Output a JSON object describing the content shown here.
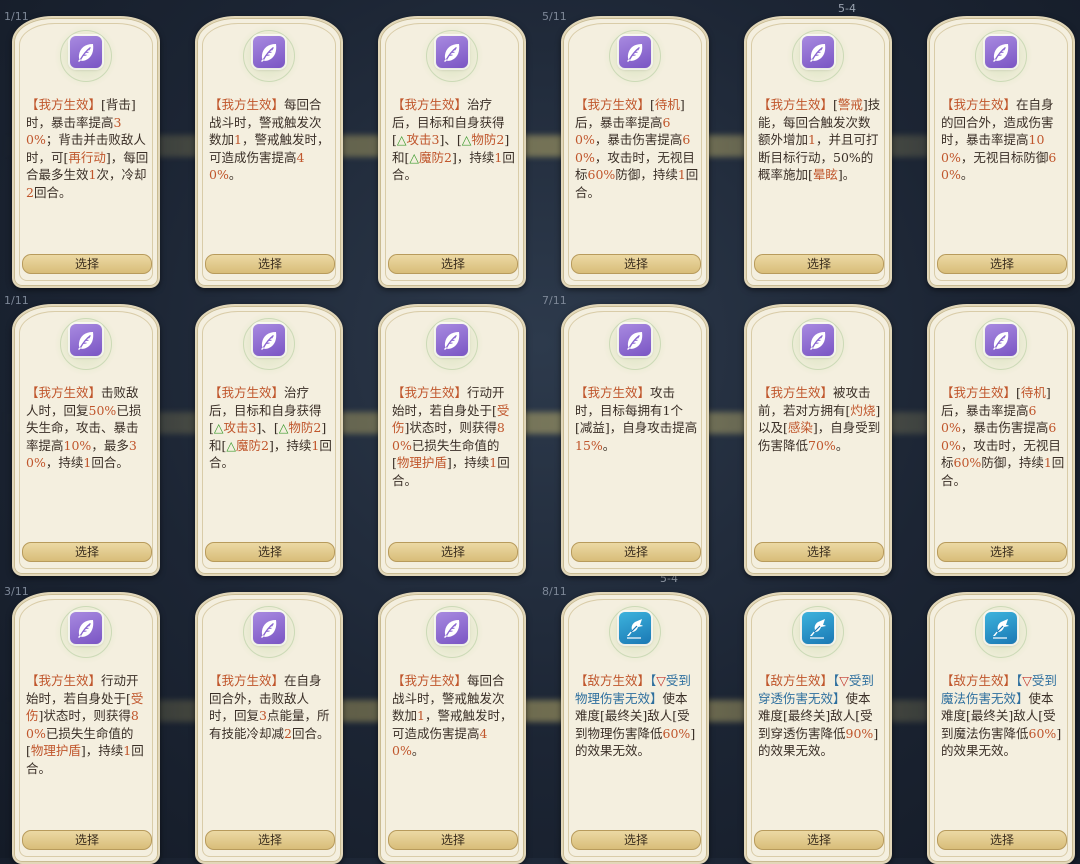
{
  "pagers": [
    "1/11",
    "5/11",
    "1/11",
    "7/11",
    "3/11",
    "8/11"
  ],
  "stage_labels": [
    "5-4",
    "5-4"
  ],
  "select_label": "选择",
  "colors": {
    "card_bg": "#f4efdf",
    "ally_icon": "#8a66d0",
    "enemy_icon": "#2a94c8",
    "highlight": "#c0562c",
    "buff_green": "#3b9a2c",
    "debuff_red": "#c0352c"
  },
  "cards": [
    {
      "icon": "leaf-icon",
      "side": "ally",
      "parts": [
        [
          "tag",
          "【我方生效】"
        ],
        [
          "t",
          "[背击]时，暴击率提高"
        ],
        [
          "num",
          "30%"
        ],
        [
          "t",
          "；背击并击败敌人时，可["
        ],
        [
          "kw",
          "再行动"
        ],
        [
          "t",
          "]，每回合最多生效"
        ],
        [
          "num",
          "1"
        ],
        [
          "t",
          "次，冷却"
        ],
        [
          "num",
          "2"
        ],
        [
          "t",
          "回合。"
        ]
      ]
    },
    {
      "icon": "leaf-icon",
      "side": "ally",
      "parts": [
        [
          "tag",
          "【我方生效】"
        ],
        [
          "t",
          "每回合战斗时，警戒触发次数加"
        ],
        [
          "num",
          "1"
        ],
        [
          "t",
          "，警戒触发时，可造成伤害提高"
        ],
        [
          "num",
          "40%"
        ],
        [
          "t",
          "。"
        ]
      ]
    },
    {
      "icon": "leaf-icon",
      "side": "ally",
      "parts": [
        [
          "tag",
          "【我方生效】"
        ],
        [
          "t",
          "治疗后，目标和自身获得["
        ],
        [
          "up",
          "△"
        ],
        [
          "kw",
          "攻击3"
        ],
        [
          "t",
          "]、["
        ],
        [
          "up",
          "△"
        ],
        [
          "kw",
          "物防2"
        ],
        [
          "t",
          "]和["
        ],
        [
          "up",
          "△"
        ],
        [
          "kw",
          "魔防2"
        ],
        [
          "t",
          "]，持续"
        ],
        [
          "num",
          "1"
        ],
        [
          "t",
          "回合。"
        ]
      ]
    },
    {
      "icon": "leaf-icon",
      "side": "ally",
      "parts": [
        [
          "tag",
          "【我方生效】"
        ],
        [
          "t",
          "["
        ],
        [
          "kw",
          "待机"
        ],
        [
          "t",
          "]后，暴击率提高"
        ],
        [
          "num",
          "60%"
        ],
        [
          "t",
          "，暴击伤害提高"
        ],
        [
          "num",
          "60%"
        ],
        [
          "t",
          "，攻击时，无视目标"
        ],
        [
          "num",
          "60%"
        ],
        [
          "t",
          "防御，持续"
        ],
        [
          "num",
          "1"
        ],
        [
          "t",
          "回合。"
        ]
      ]
    },
    {
      "icon": "leaf-icon",
      "side": "ally",
      "parts": [
        [
          "tag",
          "【我方生效】"
        ],
        [
          "t",
          "["
        ],
        [
          "kw",
          "警戒"
        ],
        [
          "t",
          "]技能，每回合触发次数额外增加"
        ],
        [
          "num",
          "1"
        ],
        [
          "t",
          "，并且可打断目标行动，50%的概率施加["
        ],
        [
          "kw",
          "晕眩"
        ],
        [
          "t",
          "]。"
        ]
      ]
    },
    {
      "icon": "leaf-icon",
      "side": "ally",
      "parts": [
        [
          "tag",
          "【我方生效】"
        ],
        [
          "t",
          "在自身的回合外，造成伤害时，暴击率提高"
        ],
        [
          "num",
          "100%"
        ],
        [
          "t",
          "，无视目标防御"
        ],
        [
          "num",
          "60%"
        ],
        [
          "t",
          "。"
        ]
      ]
    },
    {
      "icon": "leaf-icon",
      "side": "ally",
      "parts": [
        [
          "tag",
          "【我方生效】"
        ],
        [
          "t",
          "击败敌人时，回复"
        ],
        [
          "num",
          "50%"
        ],
        [
          "t",
          "已损失生命，攻击、暴击率提高"
        ],
        [
          "num",
          "10%"
        ],
        [
          "t",
          "，最多"
        ],
        [
          "num",
          "30%"
        ],
        [
          "t",
          "，持续"
        ],
        [
          "num",
          "1"
        ],
        [
          "t",
          "回合。"
        ]
      ]
    },
    {
      "icon": "leaf-icon",
      "side": "ally",
      "parts": [
        [
          "tag",
          "【我方生效】"
        ],
        [
          "t",
          "治疗后，目标和自身获得["
        ],
        [
          "up",
          "△"
        ],
        [
          "kw",
          "攻击3"
        ],
        [
          "t",
          "]、["
        ],
        [
          "up",
          "△"
        ],
        [
          "kw",
          "物防2"
        ],
        [
          "t",
          "]和["
        ],
        [
          "up",
          "△"
        ],
        [
          "kw",
          "魔防2"
        ],
        [
          "t",
          "]，持续"
        ],
        [
          "num",
          "1"
        ],
        [
          "t",
          "回合。"
        ]
      ]
    },
    {
      "icon": "leaf-icon",
      "side": "ally",
      "parts": [
        [
          "tag",
          "【我方生效】"
        ],
        [
          "t",
          "行动开始时，若自身处于["
        ],
        [
          "kw",
          "受伤"
        ],
        [
          "t",
          "]状态时，则获得"
        ],
        [
          "num",
          "80%"
        ],
        [
          "t",
          "已损失生命值的["
        ],
        [
          "kw",
          "物理护盾"
        ],
        [
          "t",
          "]，持续"
        ],
        [
          "num",
          "1"
        ],
        [
          "t",
          "回合。"
        ]
      ]
    },
    {
      "icon": "leaf-icon",
      "side": "ally",
      "parts": [
        [
          "tag",
          "【我方生效】"
        ],
        [
          "t",
          "攻击时，目标每拥有1个[减益]，自身攻击提高"
        ],
        [
          "num",
          "15%"
        ],
        [
          "t",
          "。"
        ]
      ]
    },
    {
      "icon": "leaf-icon",
      "side": "ally",
      "parts": [
        [
          "tag",
          "【我方生效】"
        ],
        [
          "t",
          "被攻击前，若对方拥有["
        ],
        [
          "kw",
          "灼烧"
        ],
        [
          "t",
          "]以及["
        ],
        [
          "kw",
          "感染"
        ],
        [
          "t",
          "]，自身受到伤害降低"
        ],
        [
          "num",
          "70%"
        ],
        [
          "t",
          "。"
        ]
      ]
    },
    {
      "icon": "leaf-icon",
      "side": "ally",
      "parts": [
        [
          "tag",
          "【我方生效】"
        ],
        [
          "t",
          "["
        ],
        [
          "kw",
          "待机"
        ],
        [
          "t",
          "]后，暴击率提高"
        ],
        [
          "num",
          "60%"
        ],
        [
          "t",
          "，暴击伤害提高"
        ],
        [
          "num",
          "60%"
        ],
        [
          "t",
          "，攻击时，无视目标"
        ],
        [
          "num",
          "60%"
        ],
        [
          "t",
          "防御，持续"
        ],
        [
          "num",
          "1"
        ],
        [
          "t",
          "回合。"
        ]
      ]
    },
    {
      "icon": "leaf-icon",
      "side": "ally",
      "parts": [
        [
          "tag",
          "【我方生效】"
        ],
        [
          "t",
          "行动开始时，若自身处于["
        ],
        [
          "kw",
          "受伤"
        ],
        [
          "t",
          "]状态时，则获得"
        ],
        [
          "num",
          "80%"
        ],
        [
          "t",
          "已损失生命值的["
        ],
        [
          "kw",
          "物理护盾"
        ],
        [
          "t",
          "]，持续"
        ],
        [
          "num",
          "1"
        ],
        [
          "t",
          "回合。"
        ]
      ]
    },
    {
      "icon": "leaf-icon",
      "side": "ally",
      "parts": [
        [
          "tag",
          "【我方生效】"
        ],
        [
          "t",
          "在自身回合外，击败敌人时，回复"
        ],
        [
          "num",
          "3"
        ],
        [
          "t",
          "点能量，所有技能冷却减"
        ],
        [
          "num",
          "2"
        ],
        [
          "t",
          "回合。"
        ]
      ]
    },
    {
      "icon": "leaf-icon",
      "side": "ally",
      "parts": [
        [
          "tag",
          "【我方生效】"
        ],
        [
          "t",
          "每回合战斗时，警戒触发次数加"
        ],
        [
          "num",
          "1"
        ],
        [
          "t",
          "，警戒触发时，可造成伤害提高"
        ],
        [
          "num",
          "40%"
        ],
        [
          "t",
          "。"
        ]
      ]
    },
    {
      "icon": "bird-icon",
      "side": "enemy",
      "parts": [
        [
          "tag",
          "【敌方生效】"
        ],
        [
          "blue",
          "【"
        ],
        [
          "dn",
          "▽"
        ],
        [
          "blue",
          "受到物理伤害无效】"
        ],
        [
          "t",
          "使本难度[最终关]敌人[受到物理伤害降低"
        ],
        [
          "num",
          "60%"
        ],
        [
          "t",
          "]的效果无效。"
        ]
      ]
    },
    {
      "icon": "bird-icon",
      "side": "enemy",
      "parts": [
        [
          "tag",
          "【敌方生效】"
        ],
        [
          "blue",
          "【"
        ],
        [
          "dn",
          "▽"
        ],
        [
          "blue",
          "受到穿透伤害无效】"
        ],
        [
          "t",
          "使本难度[最终关]敌人[受到穿透伤害降低"
        ],
        [
          "num",
          "90%"
        ],
        [
          "t",
          "]的效果无效。"
        ]
      ]
    },
    {
      "icon": "bird-icon",
      "side": "enemy",
      "parts": [
        [
          "tag",
          "【敌方生效】"
        ],
        [
          "blue",
          "【"
        ],
        [
          "dn",
          "▽"
        ],
        [
          "blue",
          "受到魔法伤害无效】"
        ],
        [
          "t",
          "使本难度[最终关]敌人[受到魔法伤害降低"
        ],
        [
          "num",
          "60%"
        ],
        [
          "t",
          "]的效果无效。"
        ]
      ]
    }
  ]
}
